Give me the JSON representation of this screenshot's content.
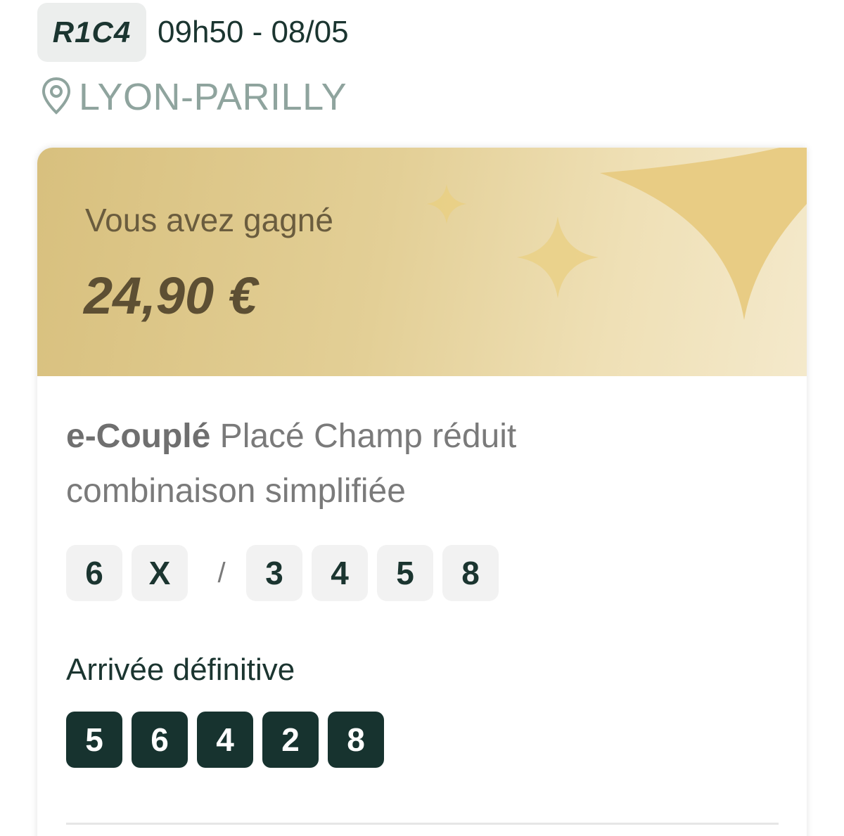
{
  "race": {
    "code": "R1C4",
    "datetime": "09h50 - 08/05",
    "venue": "LYON-PARILLY",
    "venue_icon": "location-pin-icon"
  },
  "win": {
    "label": "Vous avez gagné",
    "amount": "24,90 €"
  },
  "bet": {
    "type_bold": "e-Couplé",
    "type_rest": " Placé Champ réduit combinaison simplifiée",
    "base": [
      "6",
      "X"
    ],
    "separator": "/",
    "selections": [
      "3",
      "4",
      "5",
      "8"
    ]
  },
  "arrival": {
    "label": "Arrivée définitive",
    "numbers": [
      "5",
      "6",
      "4",
      "2",
      "8"
    ]
  },
  "colors": {
    "dark_green": "#17332f",
    "gold": "#d8c07e",
    "muted": "#8fa49e"
  }
}
